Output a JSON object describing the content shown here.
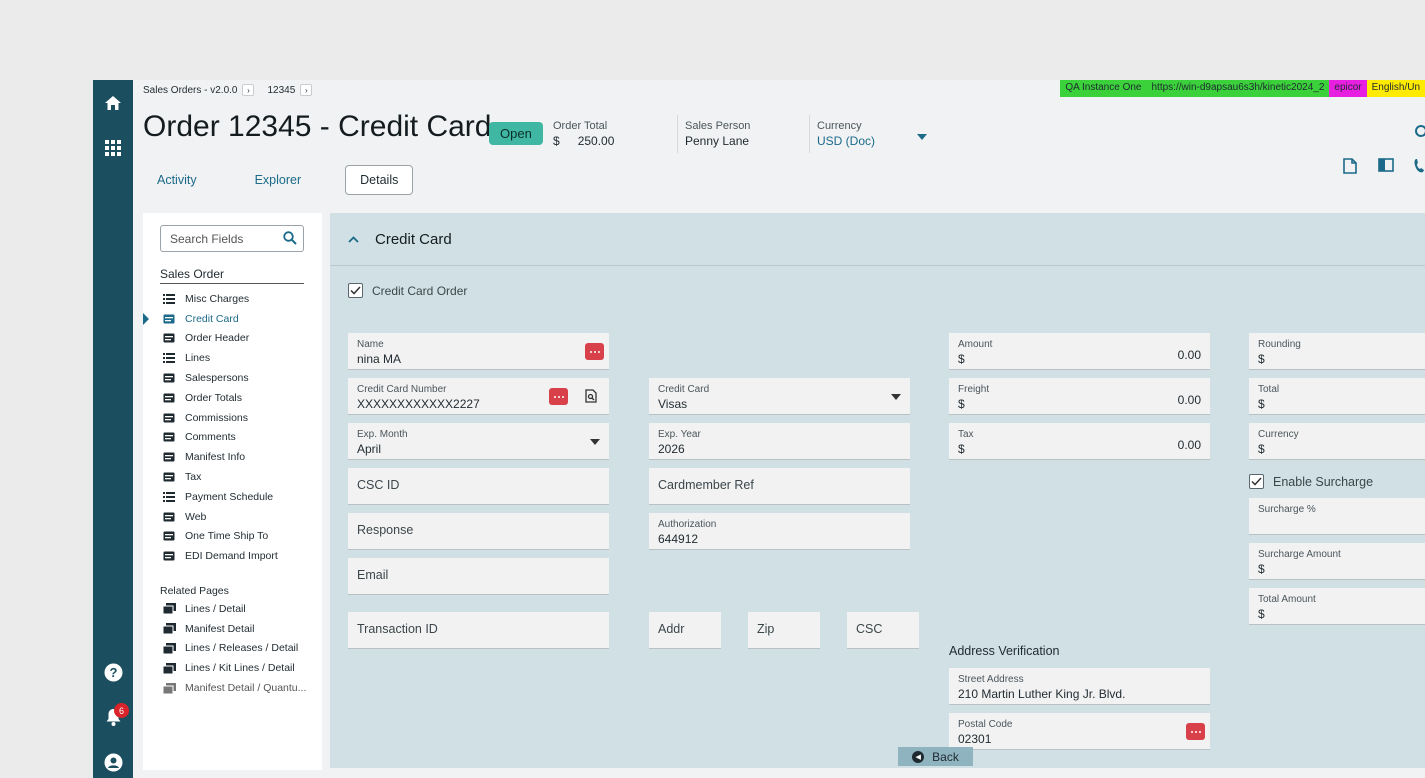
{
  "breadcrumb": {
    "app": "Sales Orders - v2.0.0",
    "record": "12345"
  },
  "env": {
    "instance": "QA Instance One",
    "url": "https://win-d9apsau6s3h/kinetic2024_2",
    "company": "epicor",
    "language": "English/Un"
  },
  "header": {
    "title": "Order 12345 - Credit Card",
    "status": "Open",
    "order_total_label": "Order Total",
    "order_total_currency": "$",
    "order_total_value": "250.00",
    "sales_person_label": "Sales Person",
    "sales_person_value": "Penny Lane",
    "currency_label": "Currency",
    "currency_value": "USD (Doc)"
  },
  "tabs": [
    {
      "label": "Activity"
    },
    {
      "label": "Explorer"
    },
    {
      "label": "Details"
    }
  ],
  "notifications": {
    "count": "6"
  },
  "sidenav": {
    "search_placeholder": "Search Fields",
    "section_title": "Sales Order",
    "items": [
      {
        "label": "Misc Charges",
        "icon": "list-icon"
      },
      {
        "label": "Credit Card",
        "icon": "card-icon"
      },
      {
        "label": "Order Header",
        "icon": "card-icon"
      },
      {
        "label": "Lines",
        "icon": "list-icon"
      },
      {
        "label": "Salespersons",
        "icon": "card-icon"
      },
      {
        "label": "Order Totals",
        "icon": "card-icon"
      },
      {
        "label": "Commissions",
        "icon": "card-icon"
      },
      {
        "label": "Comments",
        "icon": "card-icon"
      },
      {
        "label": "Manifest Info",
        "icon": "card-icon"
      },
      {
        "label": "Tax",
        "icon": "card-icon"
      },
      {
        "label": "Payment Schedule",
        "icon": "list-icon"
      },
      {
        "label": "Web",
        "icon": "card-icon"
      },
      {
        "label": "One Time Ship To",
        "icon": "card-icon"
      },
      {
        "label": "EDI Demand Import",
        "icon": "card-icon"
      }
    ],
    "related_title": "Related Pages",
    "related": [
      {
        "label": "Lines / Detail"
      },
      {
        "label": "Manifest Detail"
      },
      {
        "label": "Lines / Releases / Detail"
      },
      {
        "label": "Lines / Kit Lines / Detail"
      },
      {
        "label": "Manifest Detail / Quantu..."
      }
    ]
  },
  "section": {
    "title": "Credit Card",
    "credit_card_order_label": "Credit Card Order",
    "name_label": "Name",
    "name_value": "nina MA",
    "cc_number_label": "Credit Card Number",
    "cc_number_value": "XXXXXXXXXXXX2227",
    "cc_type_label": "Credit Card",
    "cc_type_value": "Visas",
    "exp_month_label": "Exp. Month",
    "exp_month_value": "April",
    "exp_year_label": "Exp. Year",
    "exp_year_value": "2026",
    "csc_id_label": "CSC ID",
    "cardmember_ref_label": "Cardmember Ref",
    "response_label": "Response",
    "authorization_label": "Authorization",
    "authorization_value": "644912",
    "email_label": "Email",
    "transaction_id_label": "Transaction ID",
    "addr_label": "Addr",
    "zip_label": "Zip",
    "csc_label": "CSC",
    "amount_label": "Amount",
    "amount_currency": "$",
    "amount_value": "0.00",
    "freight_label": "Freight",
    "freight_currency": "$",
    "freight_value": "0.00",
    "tax_label": "Tax",
    "tax_currency": "$",
    "tax_value": "0.00",
    "rounding_label": "Rounding",
    "rounding_currency": "$",
    "total_label": "Total",
    "total_currency": "$",
    "currency_label": "Currency",
    "currency_value": "$",
    "enable_surcharge_label": "Enable Surcharge",
    "surcharge_pct_label": "Surcharge %",
    "surcharge_amount_label": "Surcharge Amount",
    "surcharge_amount_currency": "$",
    "total_amount_label": "Total Amount",
    "total_amount_currency": "$",
    "address_verification_title": "Address Verification",
    "street_label": "Street Address",
    "street_value": "210 Martin Luther King Jr. Blvd.",
    "postal_label": "Postal Code",
    "postal_value": "02301"
  },
  "back_label": "Back",
  "colors": {
    "rail": "#1b4f5f",
    "accent": "#1b6a8a",
    "status": "#3fb7a3",
    "panel": "#d0e0e4"
  }
}
